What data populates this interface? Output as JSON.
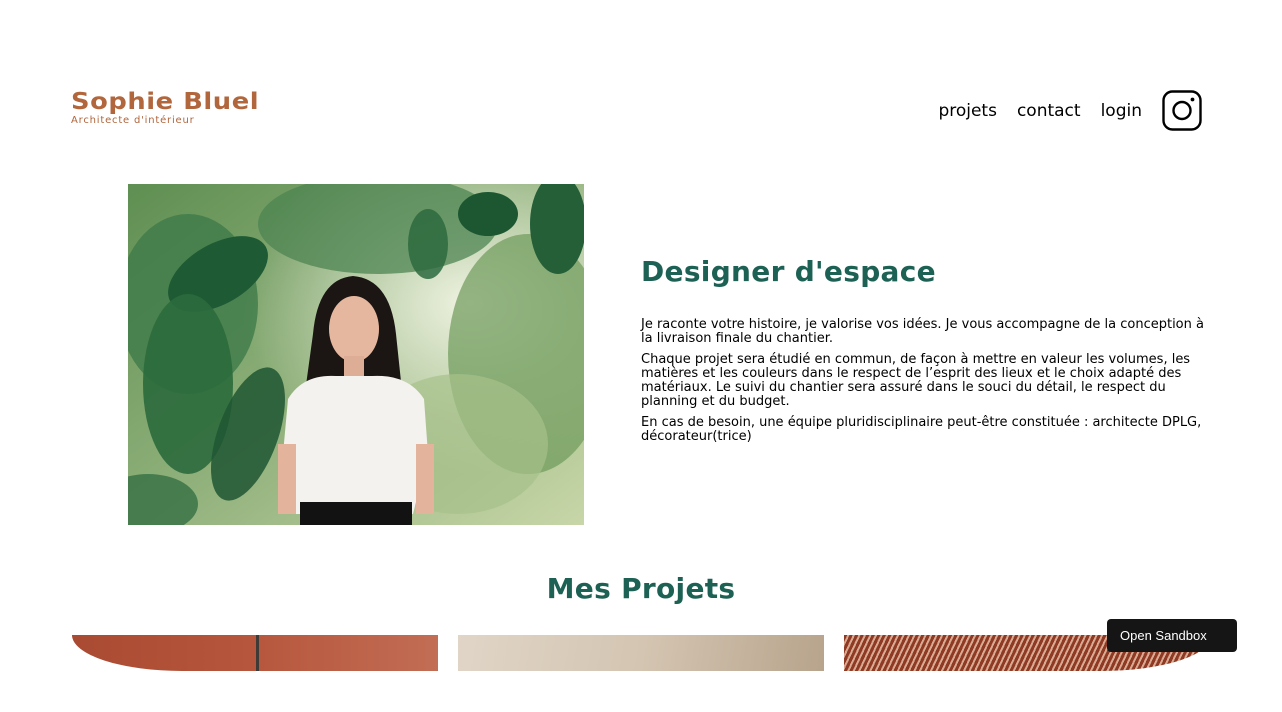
{
  "header": {
    "brand_name": "Sophie Bluel",
    "brand_subtitle": "Architecte d'intérieur",
    "nav": [
      {
        "label": "projets"
      },
      {
        "label": "contact"
      },
      {
        "label": "login"
      }
    ],
    "instagram_icon": "instagram-icon"
  },
  "intro": {
    "title": "Designer d'espace",
    "paragraphs": [
      "Je raconte votre histoire, je valorise vos idées. Je vous accompagne de la conception à la livraison finale du chantier.",
      "Chaque projet sera étudié en commun, de façon à mettre en valeur les volumes, les matières et les couleurs dans le respect de l’esprit des lieux et le choix adapté des matériaux. Le suivi du chantier sera assuré dans le souci du détail, le respect du planning et du budget.",
      "En cas de besoin, une équipe pluridisciplinaire peut-être constituée : architecte DPLG, décorateur(trice)"
    ]
  },
  "projects": {
    "title": "Mes Projets"
  },
  "sandbox": {
    "label": "Open Sandbox"
  },
  "colors": {
    "brand": "#B1663C",
    "heading": "#1D6154"
  }
}
